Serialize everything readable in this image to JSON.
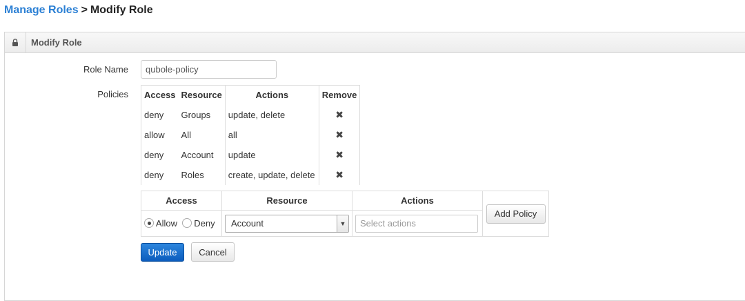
{
  "breadcrumb": {
    "parent": "Manage Roles",
    "separator": ">",
    "current": "Modify Role"
  },
  "panel": {
    "title": "Modify Role",
    "icon": "lock-icon"
  },
  "form": {
    "role_name_label": "Role Name",
    "role_name_value": "qubole-policy",
    "policies_label": "Policies"
  },
  "policies_table": {
    "headers": {
      "access": "Access",
      "resource": "Resource",
      "actions": "Actions",
      "remove": "Remove"
    },
    "rows": [
      {
        "access": "deny",
        "resource": "Groups",
        "actions": "update, delete",
        "remove": "✖"
      },
      {
        "access": "allow",
        "resource": "All",
        "actions": "all",
        "remove": "✖"
      },
      {
        "access": "deny",
        "resource": "Account",
        "actions": "update",
        "remove": "✖"
      },
      {
        "access": "deny",
        "resource": "Roles",
        "actions": "create, update, delete",
        "remove": "✖"
      }
    ]
  },
  "add_policy": {
    "headers": {
      "access": "Access",
      "resource": "Resource",
      "actions": "Actions"
    },
    "access_options": [
      {
        "label": "Allow",
        "checked": true
      },
      {
        "label": "Deny",
        "checked": false
      }
    ],
    "resource_selected": "Account",
    "actions_placeholder": "Select actions",
    "add_button": "Add Policy"
  },
  "buttons": {
    "update": "Update",
    "cancel": "Cancel"
  },
  "colors": {
    "link": "#2a7fd4",
    "primary": "#0b5cbd"
  }
}
